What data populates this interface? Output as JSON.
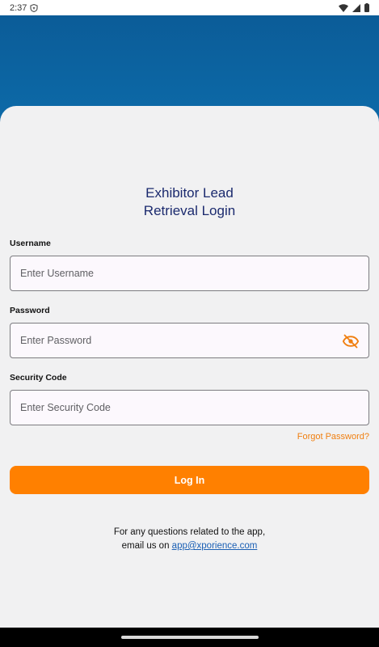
{
  "status_bar": {
    "time": "2:37"
  },
  "login": {
    "title_line1": "Exhibitor Lead",
    "title_line2": "Retrieval Login",
    "username_label": "Username",
    "username_placeholder": "Enter Username",
    "username_value": "",
    "password_label": "Password",
    "password_placeholder": "Enter Password",
    "password_value": "",
    "security_label": "Security Code",
    "security_placeholder": "Enter Security Code",
    "security_value": "",
    "forgot_password": "Forgot Password?",
    "login_button": "Log In"
  },
  "footer": {
    "line1": "For any questions related to the app,",
    "line2_prefix": "email us on",
    "email": "app@xporience.com"
  },
  "colors": {
    "primary_blue": "#0b5c98",
    "accent_orange": "#ff8000",
    "title_navy": "#1b2a6e",
    "link_blue": "#1a5fb4"
  },
  "icons": {
    "password_toggle": "eye-off-icon"
  }
}
